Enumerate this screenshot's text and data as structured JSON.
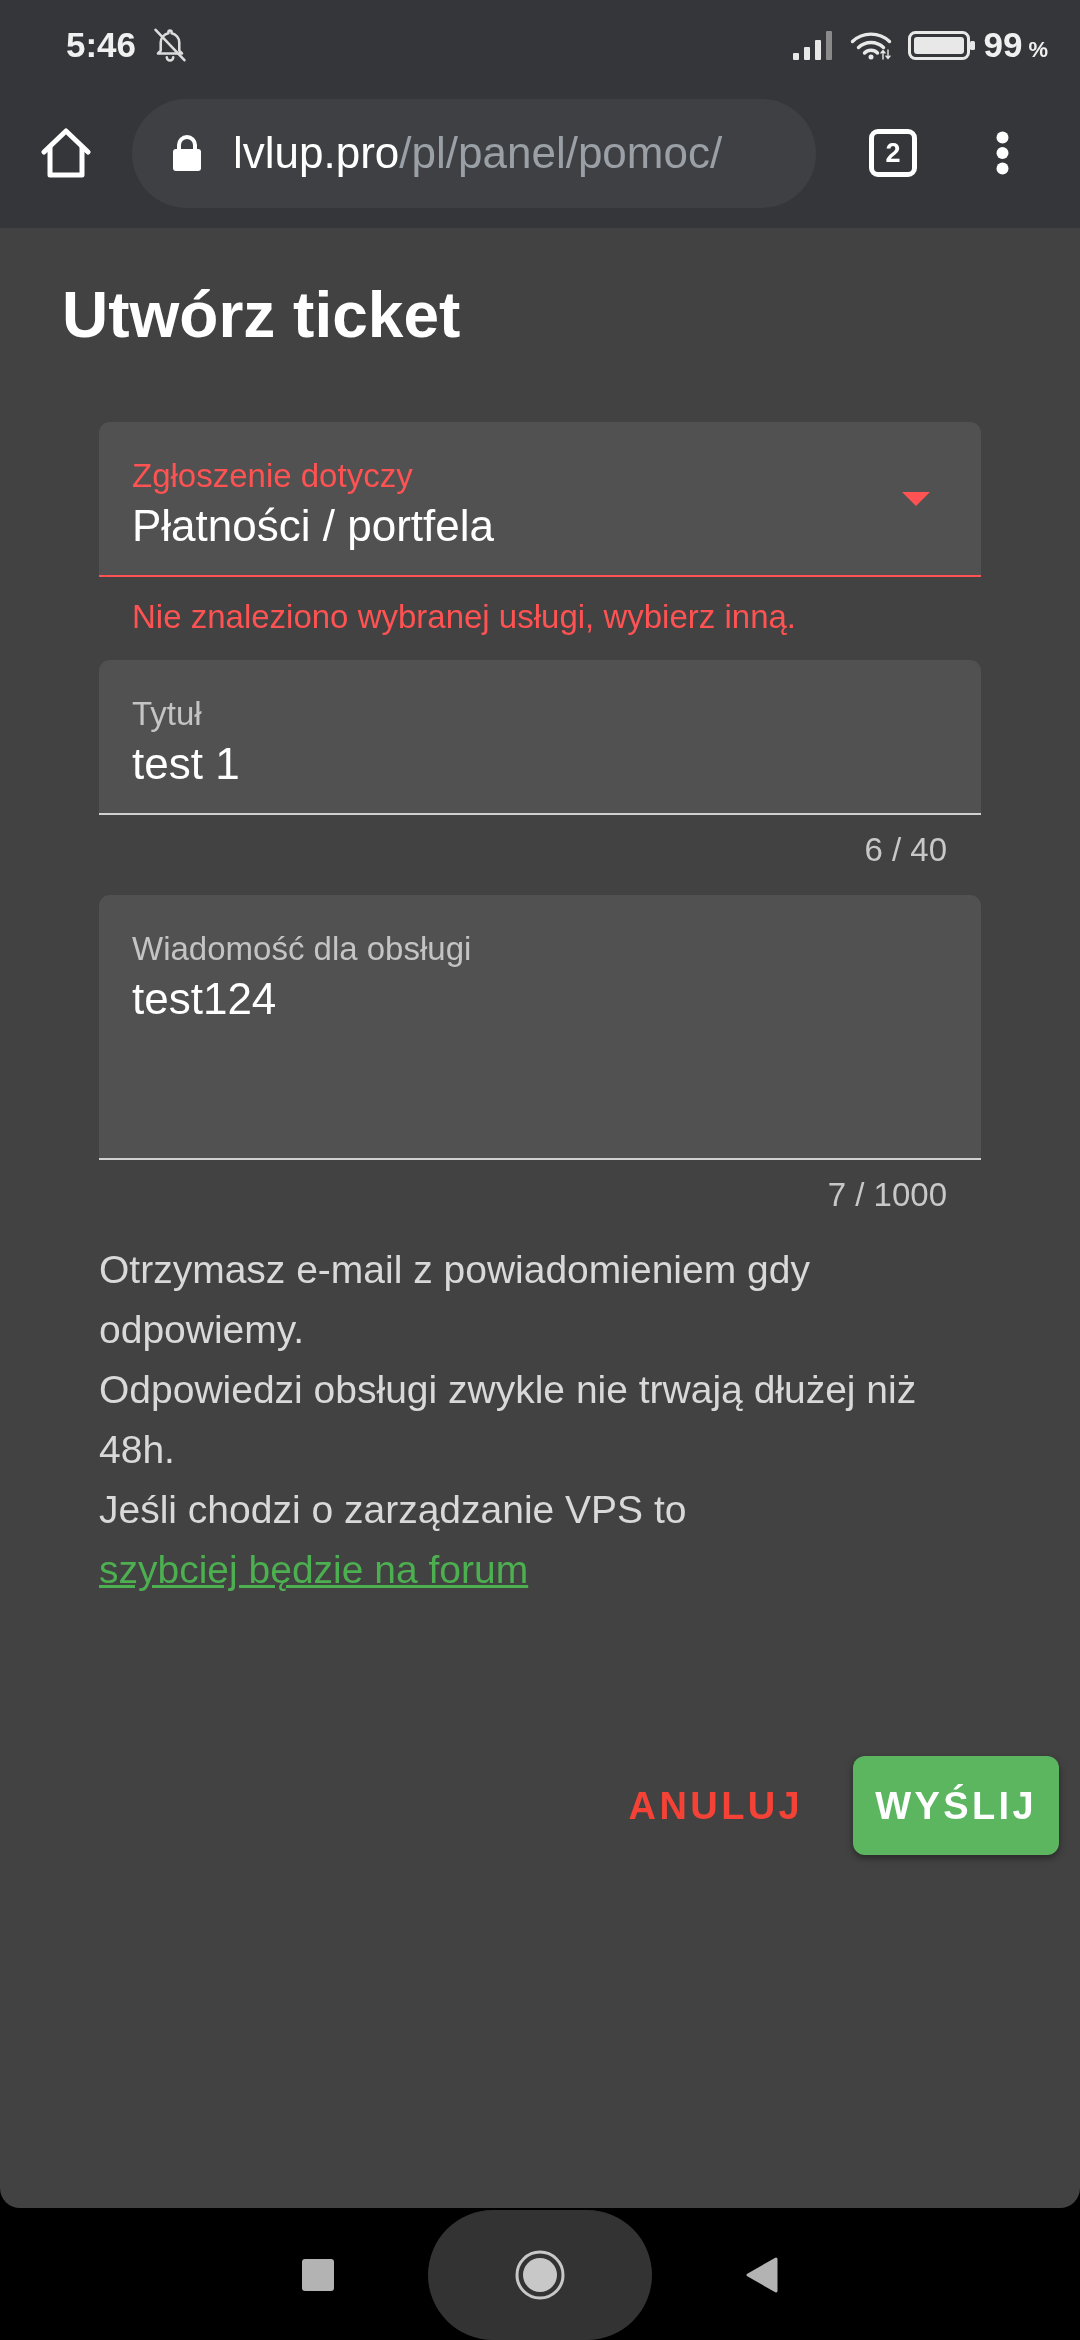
{
  "status_bar": {
    "time": "5:46",
    "battery_level_text": "99",
    "battery_unit": "%"
  },
  "browser": {
    "url_host": "lvlup.pro",
    "url_path": "/pl/panel/pomoc/",
    "tab_count": "2"
  },
  "page": {
    "title": "Utwórz ticket"
  },
  "fields": [
    {
      "kind": "select",
      "label": "Zgłoszenie dotyczy",
      "value": "Płatności / portfela",
      "error": "Nie znaleziono wybranej usługi, wybierz inną."
    },
    {
      "kind": "text",
      "label": "Tytuł",
      "value": "test 1",
      "counter": "6 / 40"
    },
    {
      "kind": "textarea",
      "label": "Wiadomość dla obsługi",
      "value": "test124",
      "counter": "7 / 1000"
    }
  ],
  "notes": [
    {
      "text": "Otrzymasz e-mail z powiadomieniem gdy odpowiemy."
    },
    {
      "text": "Odpowiedzi obsługi zwykle nie trwają dłużej niż 48h."
    },
    {
      "text": "Jeśli chodzi o zarządzanie VPS to",
      "link": "szybciej będzie na forum"
    }
  ],
  "actions": [
    {
      "kind": "text",
      "label": "ANULUJ"
    },
    {
      "kind": "filled",
      "label": "WYŚLIJ"
    }
  ]
}
